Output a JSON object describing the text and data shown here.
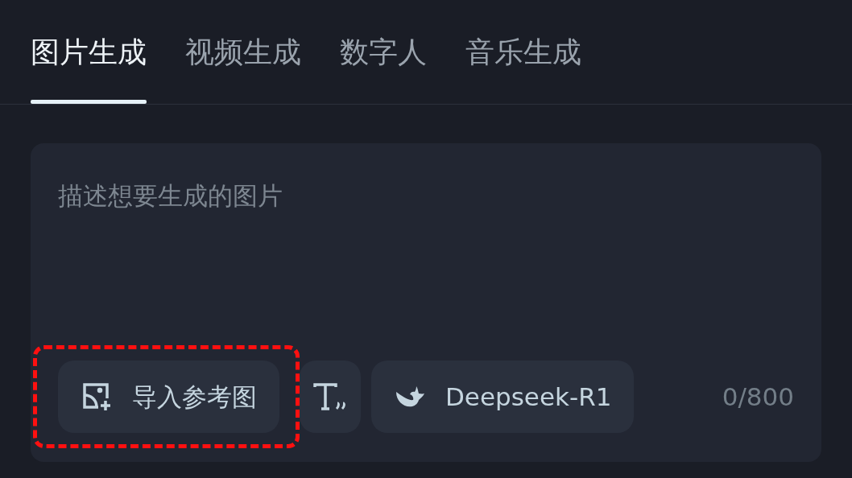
{
  "tabs": [
    {
      "label": "图片生成",
      "selected": true
    },
    {
      "label": "视频生成",
      "selected": false
    },
    {
      "label": "数字人",
      "selected": false
    },
    {
      "label": "音乐生成",
      "selected": false
    }
  ],
  "prompt": {
    "placeholder": "描述想要生成的图片"
  },
  "tools": [
    {
      "kind": "import",
      "label": "导入参考图",
      "highlighted": true
    },
    {
      "kind": "text-style",
      "highlighted": false
    },
    {
      "kind": "model",
      "label": "Deepseek-R1",
      "highlighted": false
    }
  ],
  "counter": "0/800"
}
